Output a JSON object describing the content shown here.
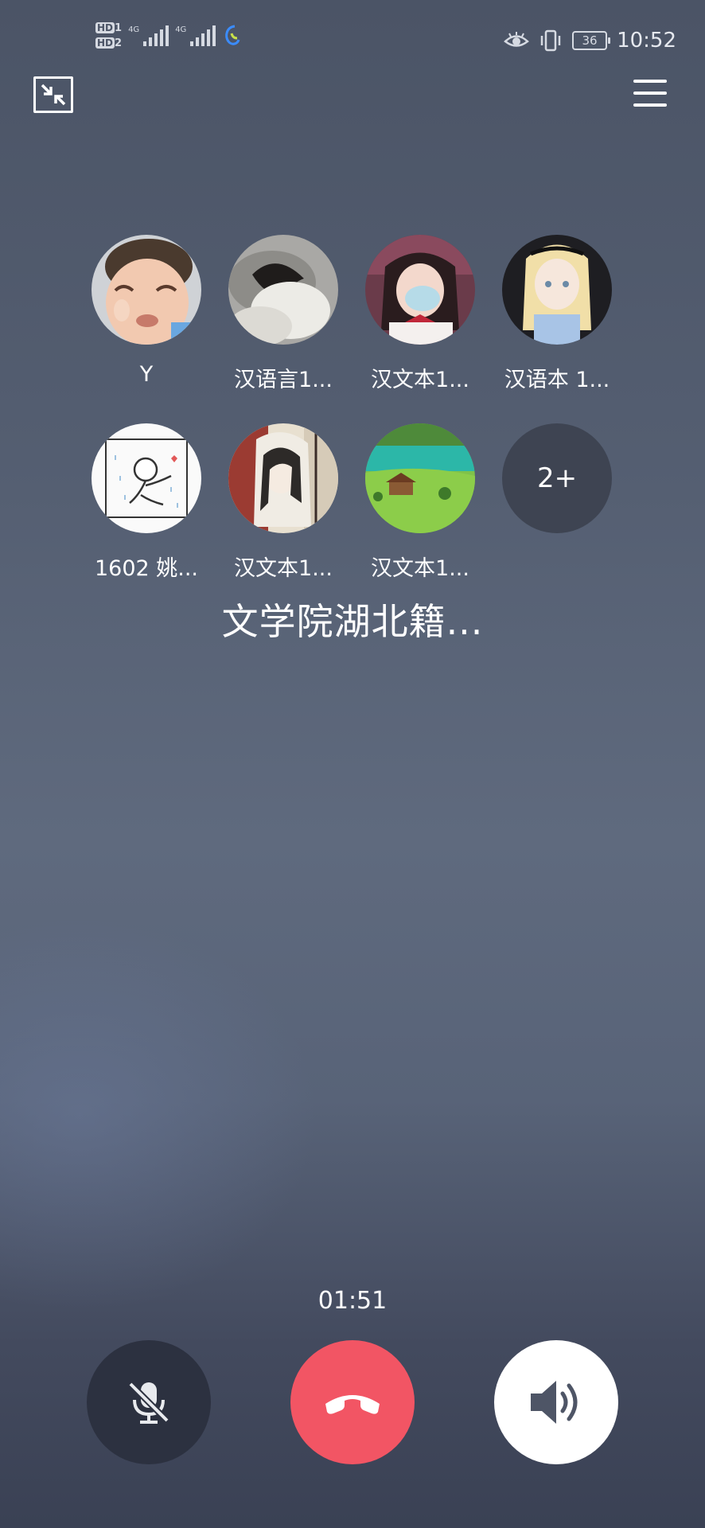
{
  "status_bar": {
    "hd1": "HD",
    "hd1_sub": "1",
    "hd2": "HD",
    "hd2_sub": "2",
    "net1": "4G",
    "net2": "4G",
    "battery": "36",
    "time": "10:52"
  },
  "participants": [
    {
      "name": "Y",
      "avatar": "boy-avatar"
    },
    {
      "name": "汉语言1...",
      "avatar": "sleeping-avatar"
    },
    {
      "name": "汉文本1...",
      "avatar": "mask-girl-avatar"
    },
    {
      "name": "汉语本 1...",
      "avatar": "alice-avatar"
    },
    {
      "name": "1602 姚...",
      "avatar": "doodle-avatar"
    },
    {
      "name": "汉文本1...",
      "avatar": "illustration-avatar"
    },
    {
      "name": "汉文本1...",
      "avatar": "landscape-avatar"
    }
  ],
  "more_count": "2+",
  "group_name": "文学院湖北籍...",
  "call_duration": "01:51",
  "colors": {
    "hangup": "#f25564",
    "mute_bg": "#2c3140",
    "speaker_bg": "#ffffff"
  }
}
